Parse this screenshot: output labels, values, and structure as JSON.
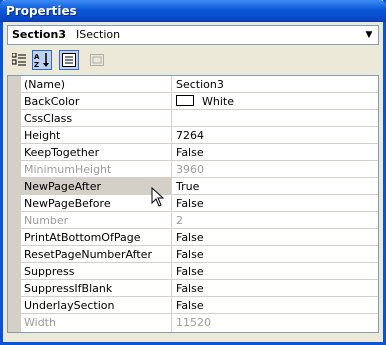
{
  "window": {
    "title": "Properties"
  },
  "object_selector": {
    "name": "Section3",
    "type": "ISection"
  },
  "toolbar": [
    {
      "icon": "categorized-icon",
      "active": false
    },
    {
      "icon": "alphabetical-sort-icon",
      "active": true
    },
    {
      "icon": "properties-icon",
      "active": true
    },
    {
      "icon": "property-pages-icon",
      "active": false,
      "disabled": true
    }
  ],
  "properties": [
    {
      "name": "(Name)",
      "value": "Section3"
    },
    {
      "name": "BackColor",
      "value": "White",
      "color_swatch": "#ffffff"
    },
    {
      "name": "CssClass",
      "value": ""
    },
    {
      "name": "Height",
      "value": "7264"
    },
    {
      "name": "KeepTogether",
      "value": "False"
    },
    {
      "name": "MinimumHeight",
      "value": "3960",
      "readonly": true
    },
    {
      "name": "NewPageAfter",
      "value": "True",
      "selected": true
    },
    {
      "name": "NewPageBefore",
      "value": "False"
    },
    {
      "name": "Number",
      "value": "2",
      "readonly": true
    },
    {
      "name": "PrintAtBottomOfPage",
      "value": "False"
    },
    {
      "name": "ResetPageNumberAfter",
      "value": "False"
    },
    {
      "name": "Suppress",
      "value": "False"
    },
    {
      "name": "SuppressIfBlank",
      "value": "False"
    },
    {
      "name": "UnderlaySection",
      "value": "False"
    },
    {
      "name": "Width",
      "value": "11520",
      "readonly": true
    }
  ]
}
